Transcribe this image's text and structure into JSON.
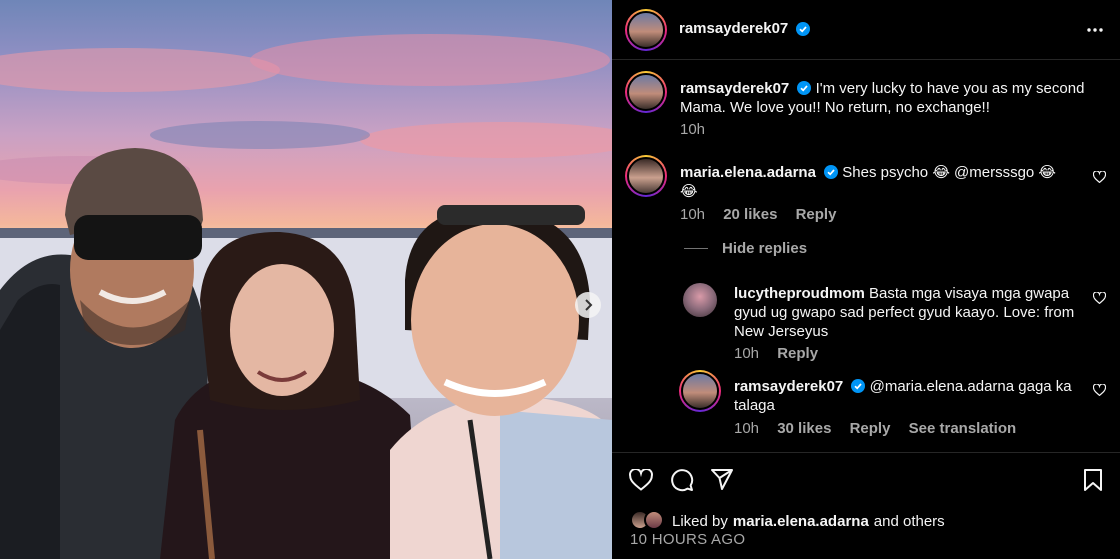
{
  "post": {
    "author": "ramsayderek07",
    "more_icon": "more-horizontal-icon"
  },
  "caption": {
    "username": "ramsayderek07",
    "text": "I'm very lucky to have you as my second Mama. We love you!! No return, no exchange!!",
    "time": "10h"
  },
  "comments": [
    {
      "username": "maria.elena.adarna",
      "text": "Shes psycho 😂 @mersssgo 😂 😂",
      "time": "10h",
      "likes": "20 likes",
      "reply_label": "Reply"
    }
  ],
  "hide_replies_label": "Hide replies",
  "replies": [
    {
      "username": "lucytheproudmom",
      "text": "Basta mga visaya mga gwapa gyud ug gwapo sad perfect gyud kaayo. Love: from New Jerseyus",
      "time": "10h",
      "reply_label": "Reply"
    },
    {
      "username": "ramsayderek07",
      "text": "@maria.elena.adarna gaga ka talaga",
      "time": "10h",
      "likes": "30 likes",
      "reply_label": "Reply",
      "translate_label": "See translation"
    }
  ],
  "likes": {
    "prefix": "Liked by",
    "user": "maria.elena.adarna",
    "suffix": "and others"
  },
  "timestamp": "10 HOURS AGO",
  "colors": {
    "background": "#000000",
    "text": "#f5f5f5",
    "muted": "#a8a8a8",
    "verified": "#0095f6"
  }
}
